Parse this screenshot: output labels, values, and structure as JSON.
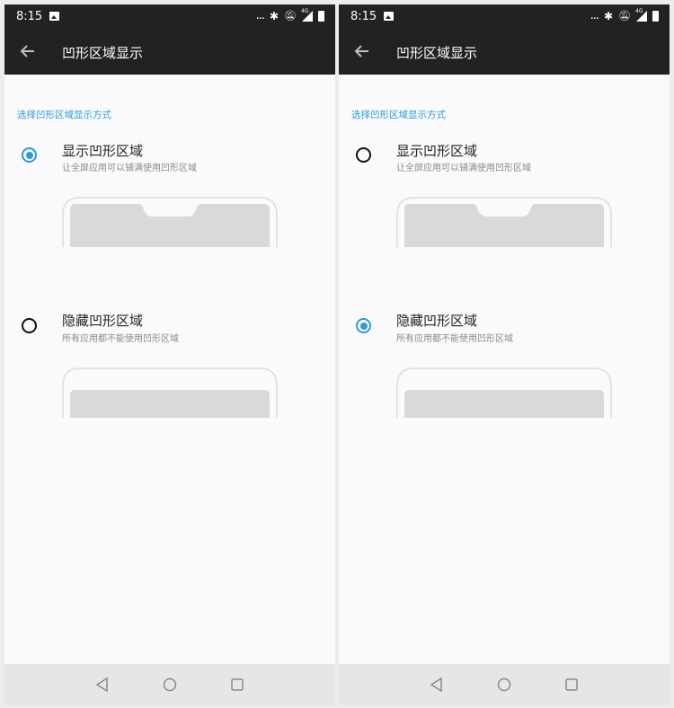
{
  "screens": [
    {
      "status": {
        "time": "8:15",
        "dots": "...",
        "network": "4G"
      },
      "toolbar": {
        "title": "凹形区域显示"
      },
      "section_header": "选择凹形区域显示方式",
      "options": [
        {
          "title": "显示凹形区域",
          "subtitle": "让全屏应用可以铺满使用凹形区域",
          "selected": true
        },
        {
          "title": "隐藏凹形区域",
          "subtitle": "所有应用都不能使用凹形区域",
          "selected": false
        }
      ]
    },
    {
      "status": {
        "time": "8:15",
        "dots": "...",
        "network": "4G"
      },
      "toolbar": {
        "title": "凹形区域显示"
      },
      "section_header": "选择凹形区域显示方式",
      "options": [
        {
          "title": "显示凹形区域",
          "subtitle": "让全屏应用可以铺满使用凹形区域",
          "selected": false
        },
        {
          "title": "隐藏凹形区域",
          "subtitle": "所有应用都不能使用凹形区域",
          "selected": true
        }
      ]
    }
  ],
  "icons": {
    "status": [
      "image-icon",
      "bluetooth-icon",
      "bell-off-icon",
      "signal-icon",
      "battery-icon"
    ],
    "toolbar": "back-arrow-icon",
    "nav": [
      "nav-back-icon",
      "nav-home-icon",
      "nav-recents-icon"
    ]
  },
  "colors": {
    "accent": "#2d9bd6",
    "bar": "#222222",
    "background": "#fafafc"
  }
}
